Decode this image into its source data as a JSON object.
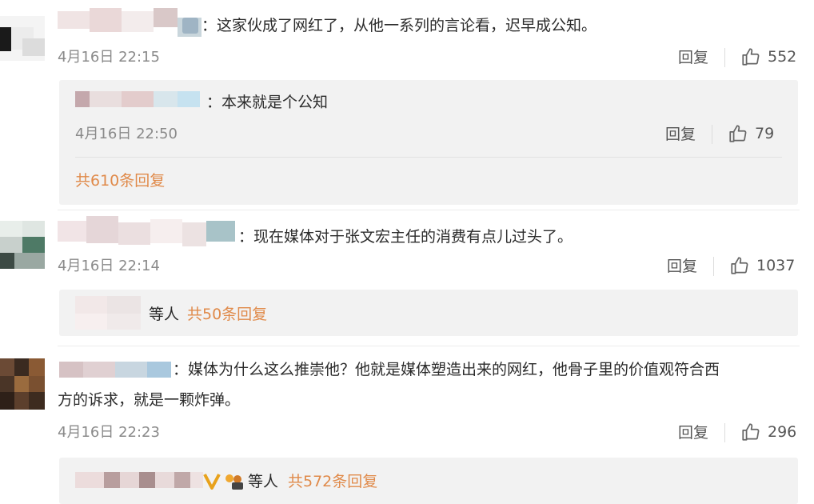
{
  "comments": [
    {
      "text": "：这家伙成了网红了，从他一系列的言论看，迟早成公知。",
      "time": "4月16日 22:15",
      "reply_label": "回复",
      "likes": "552",
      "reply": {
        "text": "：本来就是个公知",
        "time": "4月16日 22:50",
        "reply_label": "回复",
        "likes": "79"
      },
      "more_replies": "共610条回复"
    },
    {
      "text": "：现在媒体对于张文宏主任的消费有点儿过头了。",
      "time": "4月16日 22:14",
      "reply_label": "回复",
      "likes": "1037",
      "others_label": "等人",
      "more_replies": "共50条回复"
    },
    {
      "text_line1": "：媒体为什么这么推崇他？他就是媒体塑造出来的网红，他骨子里的价值观符合西",
      "text_line2": "方的诉求，就是一颗炸弹。",
      "time": "4月16日 22:23",
      "reply_label": "回复",
      "likes": "296",
      "others_label": "等人",
      "more_replies": "共572条回复"
    }
  ],
  "colors": {
    "accent_orange": "#e08a4a",
    "panel_bg": "#f2f2f2",
    "time_gray": "#8a8a8a"
  },
  "icons": {
    "like": "thumbs-up-icon",
    "verified": "verified-v-icon",
    "fans": "fans-badge-icon"
  }
}
